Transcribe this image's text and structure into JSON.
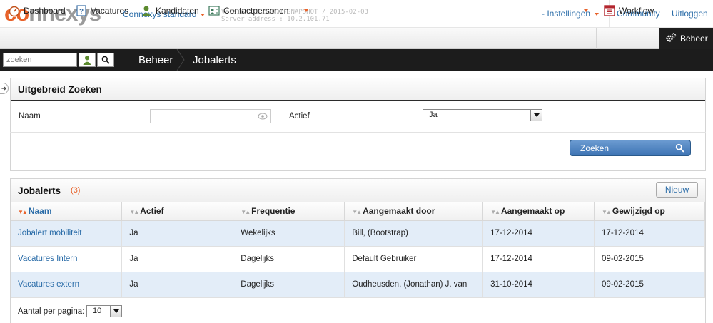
{
  "top": {
    "logo_prefix": "co",
    "logo_rest": "nnexys",
    "environment": "Connexys standard",
    "version_line1": "Version: 3.5.0.1-SNAPSHOT / 2015-02-03",
    "version_line2": "Server address : 10.2.101.71",
    "instellingen": "- Instellingen",
    "community": "Community",
    "uitloggen": "Uitloggen"
  },
  "modules": {
    "dashboard": "Dashboard",
    "vacatures": "Vacatures",
    "kandidaten": "Kandidaten",
    "contactpersonen": "Contactpersonen",
    "workflow": "Workflow",
    "beheer": "Beheer"
  },
  "search": {
    "placeholder": "zoeken"
  },
  "breadcrumb": {
    "level1": "Beheer",
    "level2": "Jobalerts"
  },
  "advanced_search": {
    "title": "Uitgebreid Zoeken",
    "name_label": "Naam",
    "name_value": "",
    "active_label": "Actief",
    "active_value": "Ja",
    "search_button": "Zoeken"
  },
  "jobalerts": {
    "title": "Jobalerts",
    "count": "(3)",
    "new_button": "Nieuw",
    "columns": [
      "Naam",
      "Actief",
      "Frequentie",
      "Aangemaakt door",
      "Aangemaakt op",
      "Gewijzigd op"
    ],
    "rows": [
      [
        "Jobalert mobiliteit",
        "Ja",
        "Wekelijks",
        "Bill, (Bootstrap)",
        "17-12-2014",
        "17-12-2014"
      ],
      [
        "Vacatures Intern",
        "Ja",
        "Dagelijks",
        "Default Gebruiker",
        "17-12-2014",
        "09-02-2015"
      ],
      [
        "Vacatures extern",
        "Ja",
        "Dagelijks",
        "Oudheusden, (Jonathan) J. van",
        "31-10-2014",
        "09-02-2015"
      ]
    ]
  },
  "pager": {
    "label": "Aantal per pagina:",
    "value": "10"
  },
  "colors": {
    "accent_orange": "#e8622a",
    "link_blue": "#2a6ca8",
    "dark_bar": "#1c1c1c",
    "row_alt": "#e3edf8"
  }
}
